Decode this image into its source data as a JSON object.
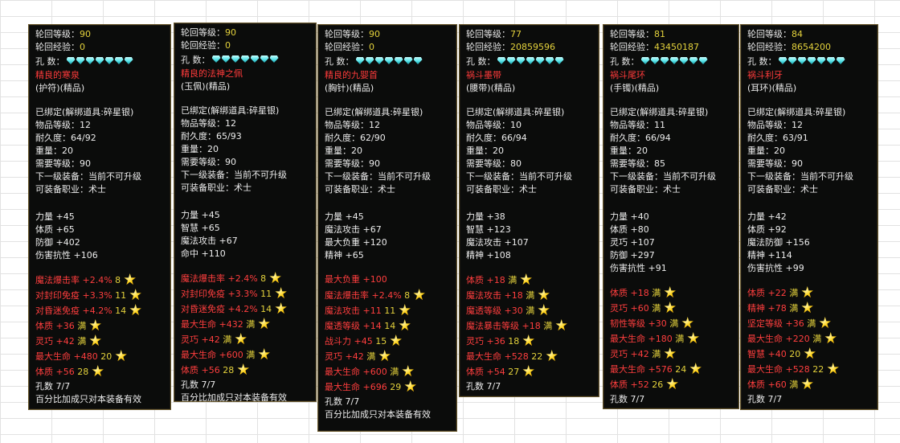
{
  "labels": {
    "lunhui_level": "轮回等级：",
    "lunhui_exp": "轮回经验：",
    "holes": "孔      数：",
    "footer": "百分比加成只对本装备有效"
  },
  "panels": [
    {
      "lunhui_level": "90",
      "lunhui_exp": "0",
      "name": "精良的寒泉",
      "type": "(护符)(精品)",
      "info": [
        "已绑定(解绑道具:碎星银)",
        "物品等级：12",
        "耐久度：64/92",
        "重量：20",
        "需要等级：90",
        "下一级装备：当前不可升级",
        "可装备职业：术士"
      ],
      "stats": [
        "力量 +45",
        "体质 +65",
        "防御 +402",
        "伤害抗性 +106"
      ],
      "affixes": [
        {
          "name": "魔法爆击率",
          "val": "+2.4%",
          "lv": "8"
        },
        {
          "name": "对封印免疫",
          "val": "+3.3%",
          "lv": "11"
        },
        {
          "name": "对昏迷免疫",
          "val": "+4.2%",
          "lv": "14"
        },
        {
          "name": "体质",
          "val": "+36",
          "lv": "满"
        },
        {
          "name": "灵巧",
          "val": "+42",
          "lv": "满"
        },
        {
          "name": "最大生命",
          "val": "+480",
          "lv": "20"
        },
        {
          "name": "体质",
          "val": "+56",
          "lv": "28"
        }
      ],
      "holes_text": "孔数 7/7",
      "footer": "百分比加成只对本装备有效"
    },
    {
      "lunhui_level": "90",
      "lunhui_exp": "0",
      "name": "精良的法神之佩",
      "type": "(玉佩)(精品)",
      "info": [
        "已绑定(解绑道具:碎星银)",
        "物品等级：12",
        "耐久度：65/93",
        "重量：20",
        "需要等级：90",
        "下一级装备：当前不可升级",
        "可装备职业：术士"
      ],
      "stats": [
        "力量 +45",
        "智慧 +65",
        "魔法攻击 +67",
        "命中 +110"
      ],
      "affixes": [
        {
          "name": "魔法爆击率",
          "val": "+2.4%",
          "lv": "8"
        },
        {
          "name": "对封印免疫",
          "val": "+3.3%",
          "lv": "11"
        },
        {
          "name": "对昏迷免疫",
          "val": "+4.2%",
          "lv": "14"
        },
        {
          "name": "最大生命",
          "val": "+432",
          "lv": "满"
        },
        {
          "name": "灵巧",
          "val": "+42",
          "lv": "满"
        },
        {
          "name": "最大生命",
          "val": "+600",
          "lv": "满"
        },
        {
          "name": "体质",
          "val": "+56",
          "lv": "28"
        }
      ],
      "holes_text": "孔数 7/7",
      "footer": "百分比加成只对本装备有效"
    },
    {
      "lunhui_level": "90",
      "lunhui_exp": "0",
      "name": "精良的九婴首",
      "type": "(胸针)(精品)",
      "info": [
        "已绑定(解绑道具:碎星银)",
        "物品等级：12",
        "耐久度：62/90",
        "重量：20",
        "需要等级：90",
        "下一级装备：当前不可升级",
        "可装备职业：术士"
      ],
      "stats": [
        "力量 +45",
        "魔法攻击 +67",
        "最大负重 +120",
        "精神 +65"
      ],
      "affixes": [
        {
          "name": "最大负重",
          "val": "+100",
          "lv": ""
        },
        {
          "name": "魔法爆击率",
          "val": "+2.4%",
          "lv": "8"
        },
        {
          "name": "魔法攻击",
          "val": "+11",
          "lv": "11"
        },
        {
          "name": "魔透等级",
          "val": "+14",
          "lv": "14"
        },
        {
          "name": "战斗力",
          "val": "+45",
          "lv": "15"
        },
        {
          "name": "灵巧",
          "val": "+42",
          "lv": "满"
        },
        {
          "name": "最大生命",
          "val": "+600",
          "lv": "满"
        },
        {
          "name": "最大生命",
          "val": "+696",
          "lv": "29"
        }
      ],
      "holes_text": "孔数 7/7",
      "footer": "百分比加成只对本装备有效"
    },
    {
      "lunhui_level": "77",
      "lunhui_exp": "20859596",
      "name": "祸斗墨带",
      "type": "(腰带)(精品)",
      "info": [
        "已绑定(解绑道具:碎星银)",
        "物品等级：10",
        "耐久度：66/94",
        "重量：20",
        "需要等级：80",
        "下一级装备：当前不可升级",
        "可装备职业：术士"
      ],
      "stats": [
        "力量 +38",
        "智慧 +123",
        "魔法攻击 +107",
        "精神 +108"
      ],
      "affixes": [
        {
          "name": "体质",
          "val": "+18",
          "lv": "满"
        },
        {
          "name": "魔法攻击",
          "val": "+18",
          "lv": "满"
        },
        {
          "name": "魔透等级",
          "val": "+30",
          "lv": "满"
        },
        {
          "name": "魔法暴击等级",
          "val": "+18",
          "lv": "满"
        },
        {
          "name": "灵巧",
          "val": "+36",
          "lv": "18"
        },
        {
          "name": "最大生命",
          "val": "+528",
          "lv": "22"
        },
        {
          "name": "体质",
          "val": "+54",
          "lv": "27"
        }
      ],
      "holes_text": "孔数 7/7",
      "footer": ""
    },
    {
      "lunhui_level": "81",
      "lunhui_exp": "43450187",
      "name": "祸斗尾环",
      "type": "(手镯)(精品)",
      "info": [
        "已绑定(解绑道具:碎星银)",
        "物品等级：11",
        "耐久度：66/94",
        "重量：20",
        "需要等级：85",
        "下一级装备：当前不可升级",
        "可装备职业：术士"
      ],
      "stats": [
        "力量 +40",
        "体质 +80",
        "灵巧 +107",
        "防御 +297",
        "伤害抗性 +91"
      ],
      "affixes": [
        {
          "name": "体质",
          "val": "+18",
          "lv": "满"
        },
        {
          "name": "灵巧",
          "val": "+60",
          "lv": "满"
        },
        {
          "name": "韧性等级",
          "val": "+30",
          "lv": "满"
        },
        {
          "name": "最大生命",
          "val": "+180",
          "lv": "满"
        },
        {
          "name": "灵巧",
          "val": "+42",
          "lv": "满"
        },
        {
          "name": "最大生命",
          "val": "+576",
          "lv": "24"
        },
        {
          "name": "体质",
          "val": "+52",
          "lv": "26"
        }
      ],
      "holes_text": "孔数 7/7",
      "footer": ""
    },
    {
      "lunhui_level": "84",
      "lunhui_exp": "8654200",
      "name": "祸斗利牙",
      "type": "(耳环)(精品)",
      "info": [
        "已绑定(解绑道具:碎星银)",
        "物品等级：12",
        "耐久度：63/91",
        "重量：20",
        "需要等级：90",
        "下一级装备：当前不可升级",
        "可装备职业：术士"
      ],
      "stats": [
        "力量 +42",
        "体质 +92",
        "魔法防御 +156",
        "精神 +114",
        "伤害抗性 +99"
      ],
      "affixes": [
        {
          "name": "体质",
          "val": "+22",
          "lv": "满"
        },
        {
          "name": "精神",
          "val": "+78",
          "lv": "满"
        },
        {
          "name": "坚定等级",
          "val": "+36",
          "lv": "满"
        },
        {
          "name": "最大生命",
          "val": "+220",
          "lv": "满"
        },
        {
          "name": "智慧",
          "val": "+40",
          "lv": "20"
        },
        {
          "name": "最大生命",
          "val": "+528",
          "lv": "22"
        },
        {
          "name": "体质",
          "val": "+60",
          "lv": "满"
        }
      ],
      "holes_text": "孔数 7/7",
      "footer": ""
    }
  ]
}
